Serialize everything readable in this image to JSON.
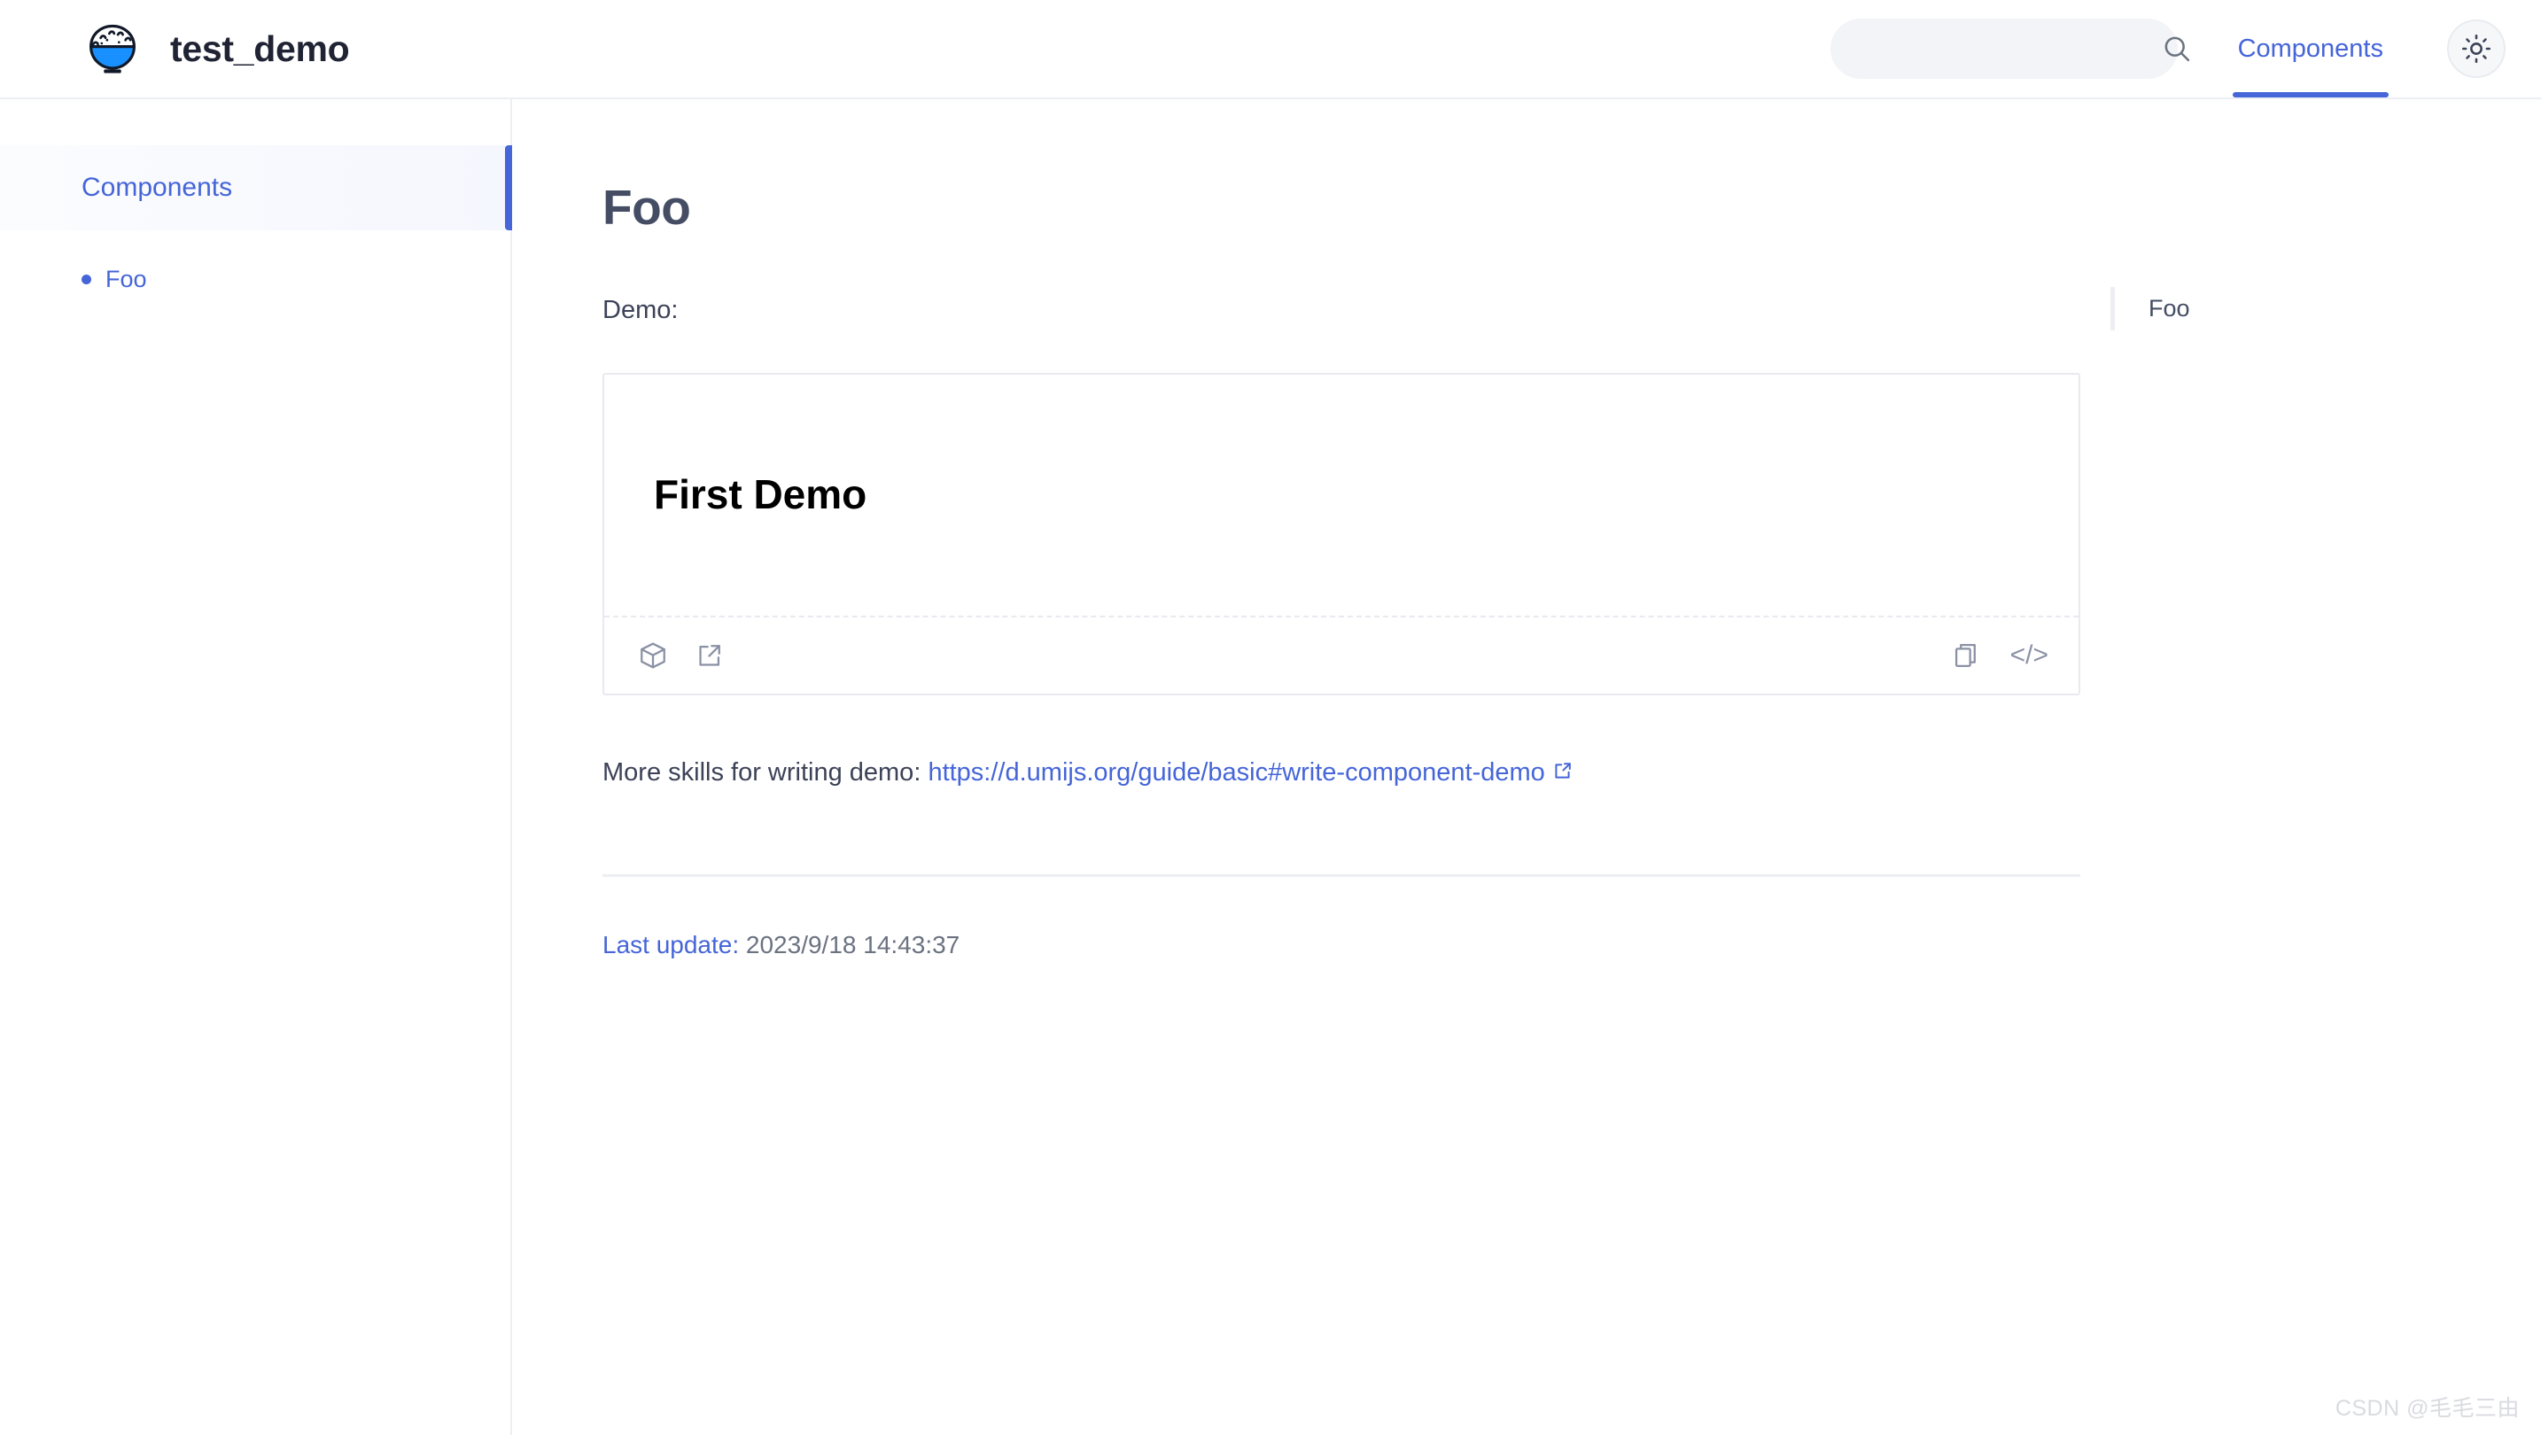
{
  "header": {
    "brand_title": "test_demo",
    "logo_icon": "rice-bowl-logo",
    "search": {
      "value": "",
      "placeholder": "",
      "icon": "search-icon"
    },
    "nav": [
      {
        "label": "Components",
        "active": true
      }
    ],
    "theme_toggle": {
      "icon": "sun-icon",
      "mode": "light"
    }
  },
  "sidebar": {
    "group_title": "Components",
    "items": [
      {
        "label": "Foo",
        "bullet": true,
        "active": true
      }
    ]
  },
  "main": {
    "page_title": "Foo",
    "demo_label": "Demo:",
    "demo": {
      "heading": "First Demo",
      "toolbar_left": [
        {
          "icon": "codesandbox-box-icon",
          "name": "open-in-codesandbox"
        },
        {
          "icon": "external-link-icon",
          "name": "open-demo-in-new-window"
        }
      ],
      "toolbar_right": [
        {
          "icon": "copy-icon",
          "name": "copy-code"
        },
        {
          "icon": "code-icon",
          "name": "toggle-source-code",
          "glyph": "</>"
        }
      ]
    },
    "skills_text": "More skills for writing demo:",
    "skills_link": "https://d.umijs.org/guide/basic#write-component-demo",
    "last_update_label": "Last update:",
    "last_update_value": "2023/9/18 14:43:37"
  },
  "toc": {
    "items": [
      {
        "label": "Foo",
        "active": true
      }
    ]
  },
  "watermark": "CSDN @毛毛三由",
  "colors": {
    "accent": "#4565d8",
    "title": "#454d64",
    "text": "#3c4257",
    "muted": "#6b7280",
    "border": "#eceef3",
    "demo_border": "#e9e9f0",
    "search_bg": "#f3f4f7"
  }
}
